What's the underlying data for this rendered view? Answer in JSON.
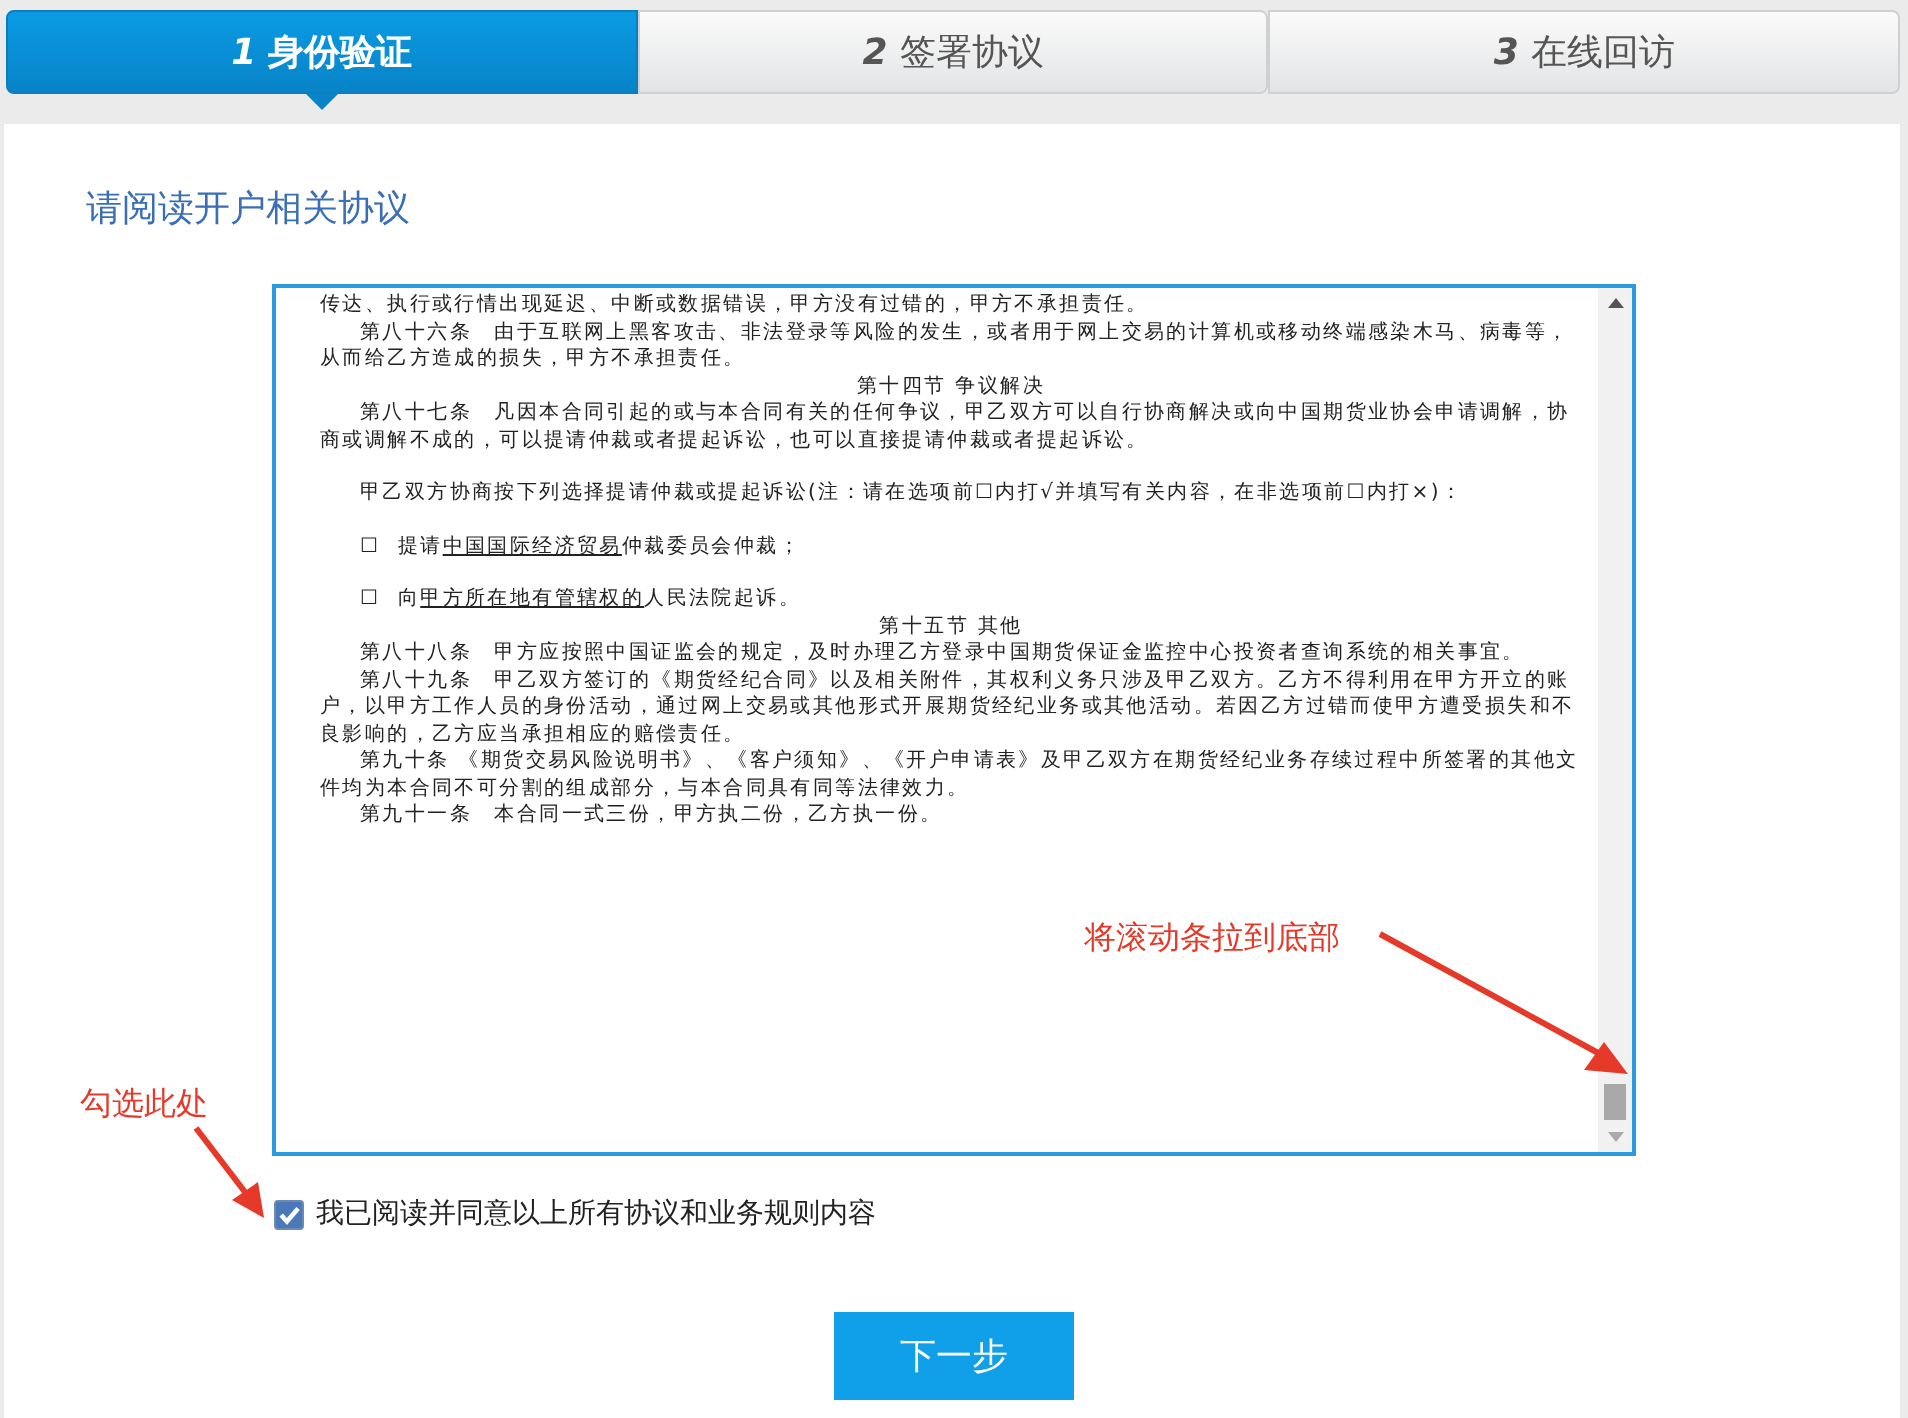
{
  "steps": [
    {
      "number": "1",
      "label": "身份验证",
      "selected": true
    },
    {
      "number": "2",
      "label": "签署协议",
      "selected": false
    },
    {
      "number": "3",
      "label": "在线回访",
      "selected": false
    }
  ],
  "heading": "请阅读开户相关协议",
  "agreement": [
    {
      "kind": "continued",
      "text": "传达、执行或行情出现延迟、中断或数据错误，甲方没有过错的，甲方不承担责任。"
    },
    {
      "kind": "para",
      "text": "第八十六条　由于互联网上黑客攻击、非法登录等风险的发生，或者用于网上交易的计算机或移动终端感染木马、病毒等，从而给乙方造成的损失，甲方不承担责任。"
    },
    {
      "kind": "heading",
      "text": "第十四节 争议解决"
    },
    {
      "kind": "para",
      "text": "第八十七条　凡因本合同引起的或与本合同有关的任何争议，甲乙双方可以自行协商解决或向中国期货业协会申请调解，协商或调解不成的，可以提请仲裁或者提起诉讼，也可以直接提请仲裁或者提起诉讼。"
    },
    {
      "kind": "gap"
    },
    {
      "kind": "para",
      "text": "甲乙双方协商按下列选择提请仲裁或提起诉讼(注：请在选项前☐内打√并填写有关内容，在非选项前☐内打×)："
    },
    {
      "kind": "gap"
    },
    {
      "kind": "option",
      "box": "☐",
      "before": "提请",
      "underlined": "中国国际经济贸易",
      "after": "仲裁委员会仲裁；"
    },
    {
      "kind": "gap"
    },
    {
      "kind": "option",
      "box": "☐",
      "before": "向",
      "underlined": "甲方所在地有管辖权的",
      "after": "人民法院起诉。"
    },
    {
      "kind": "heading",
      "text": "第十五节 其他"
    },
    {
      "kind": "para",
      "text": "第八十八条　甲方应按照中国证监会的规定，及时办理乙方登录中国期货保证金监控中心投资者查询系统的相关事宜。"
    },
    {
      "kind": "para",
      "text": "第八十九条　甲乙双方签订的《期货经纪合同》以及相关附件，其权利义务只涉及甲乙双方。乙方不得利用在甲方开立的账户，以甲方工作人员的身份活动，通过网上交易或其他形式开展期货经纪业务或其他活动。若因乙方过错而使甲方遭受损失和不良影响的，乙方应当承担相应的赔偿责任。"
    },
    {
      "kind": "para",
      "text": "第九十条 《期货交易风险说明书》、《客户须知》、《开户申请表》及甲乙双方在期货经纪业务存续过程中所签署的其他文件均为本合同不可分割的组成部分，与本合同具有同等法律效力。"
    },
    {
      "kind": "para",
      "text": "第九十一条　本合同一式三份，甲方执二份，乙方执一份。"
    }
  ],
  "agree": {
    "label": "我已阅读并同意以上所有协议和业务规则内容",
    "checked": true
  },
  "next_button": "下一步",
  "annotations": [
    {
      "text": "将滚动条拉到底部"
    },
    {
      "text": "勾选此处"
    }
  ]
}
